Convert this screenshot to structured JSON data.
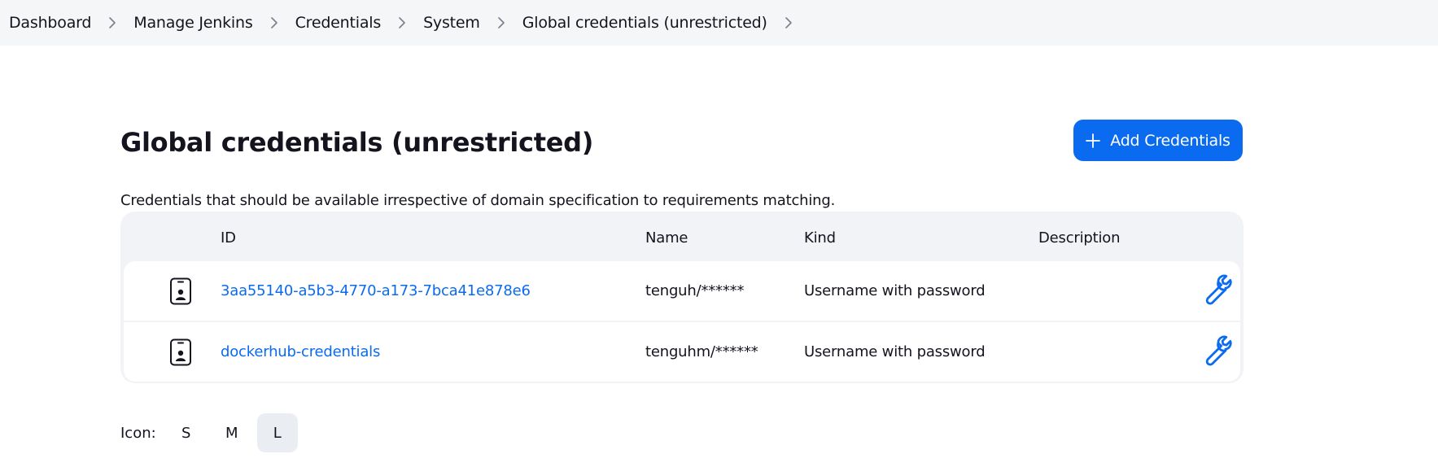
{
  "breadcrumb": [
    {
      "label": "Dashboard"
    },
    {
      "label": "Manage Jenkins"
    },
    {
      "label": "Credentials"
    },
    {
      "label": "System"
    },
    {
      "label": "Global credentials (unrestricted)"
    }
  ],
  "page": {
    "title": "Global credentials (unrestricted)",
    "add_button_label": "Add Credentials",
    "description": "Credentials that should be available irrespective of domain specification to requirements matching."
  },
  "table": {
    "headers": {
      "id": "ID",
      "name": "Name",
      "kind": "Kind",
      "description": "Description"
    },
    "rows": [
      {
        "id": "3aa55140-a5b3-4770-a173-7bca41e878e6",
        "name": "tenguh/******",
        "kind": "Username with password",
        "description": ""
      },
      {
        "id": "dockerhub-credentials",
        "name": "tenguhm/******",
        "kind": "Username with password",
        "description": ""
      }
    ]
  },
  "icon_size": {
    "label": "Icon:",
    "options": [
      "S",
      "M",
      "L"
    ],
    "selected": "L"
  },
  "colors": {
    "accent": "#0b6bf0",
    "breadcrumb_bg": "#f5f6f8",
    "table_bg": "#f1f3f6"
  },
  "icons": {
    "separator": "chevron-right-icon",
    "add": "plus-icon",
    "credential": "id-badge-icon",
    "update": "wrench-icon"
  }
}
